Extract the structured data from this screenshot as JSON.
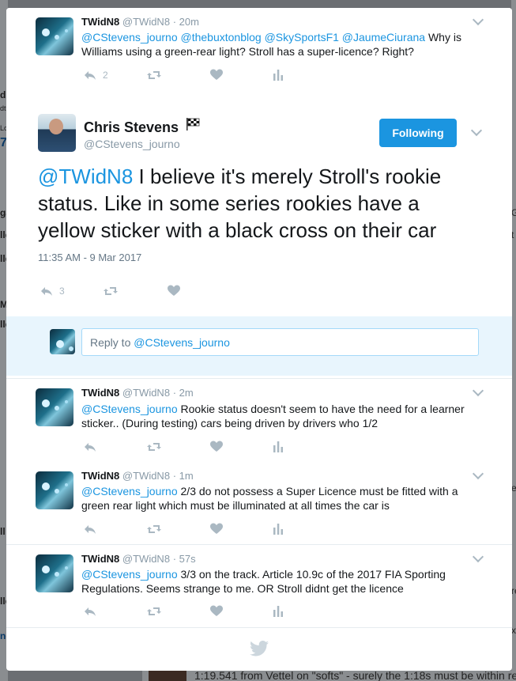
{
  "background": {
    "left_fragments": [
      "d",
      "dt",
      "Lo",
      "7",
      "ga",
      "lle",
      "lle",
      "M",
      "lle",
      "ll",
      "lle",
      "ne"
    ],
    "right_fragments": [
      "G",
      "t",
      "e",
      "re",
      "x"
    ],
    "bottom_text": "1:19.541 from Vettel on \"softs\" - surely the 1:18s must be within re"
  },
  "top_tweet": {
    "name": "TWidN8",
    "handle": "@TWidN8",
    "time": "· 20m",
    "mentions": "@CStevens_journo @thebuxtonblog @SkySportsF1 @JaumeCiurana",
    "text": " Why is Williams using a green-rear light? Stroll has a super-licence? Right?",
    "reply_count": "2"
  },
  "main_tweet": {
    "name": "Chris Stevens",
    "handle": "@CStevens_journo",
    "follow_label": "Following",
    "mention": "@TWidN8",
    "text": " I believe it's merely Stroll's rookie status. Like in some series rookies have a yellow sticker with a black cross on their car",
    "timestamp": "11:35 AM - 9 Mar 2017",
    "reply_count": "3"
  },
  "reply_box": {
    "prefix": "Reply to ",
    "handle": "@CStevens_journo"
  },
  "replies": [
    {
      "name": "TWidN8",
      "handle": "@TWidN8",
      "time": "· 2m",
      "mention": "@CStevens_journo",
      "text": " Rookie status doesn't seem to have the need for a learner sticker.. (During testing) cars being driven by drivers who 1/2"
    },
    {
      "name": "TWidN8",
      "handle": "@TWidN8",
      "time": "· 1m",
      "mention": "@CStevens_journo",
      "text": " 2/3 do not possess a Super Licence must be fitted with a green rear light which must be illuminated at all times the car is"
    },
    {
      "name": "TWidN8",
      "handle": "@TWidN8",
      "time": "· 57s",
      "mention": "@CStevens_journo",
      "text": " 3/3  on the track. Article 10.9c of the 2017 FIA Sporting Regulations. Seems strange to me. OR Stroll didnt get the licence"
    }
  ],
  "icons": {
    "reply": "reply-icon",
    "retweet": "retweet-icon",
    "like": "heart-icon",
    "analytics": "analytics-icon",
    "more": "chevron-down-icon",
    "footer": "twitter-bird-icon",
    "badge": "checkered-flag-icon"
  },
  "colors": {
    "accent": "#1b95e0",
    "icon": "#aab8c2",
    "reply_zone": "#e8f5fd",
    "overlay": "#6b6e72"
  }
}
